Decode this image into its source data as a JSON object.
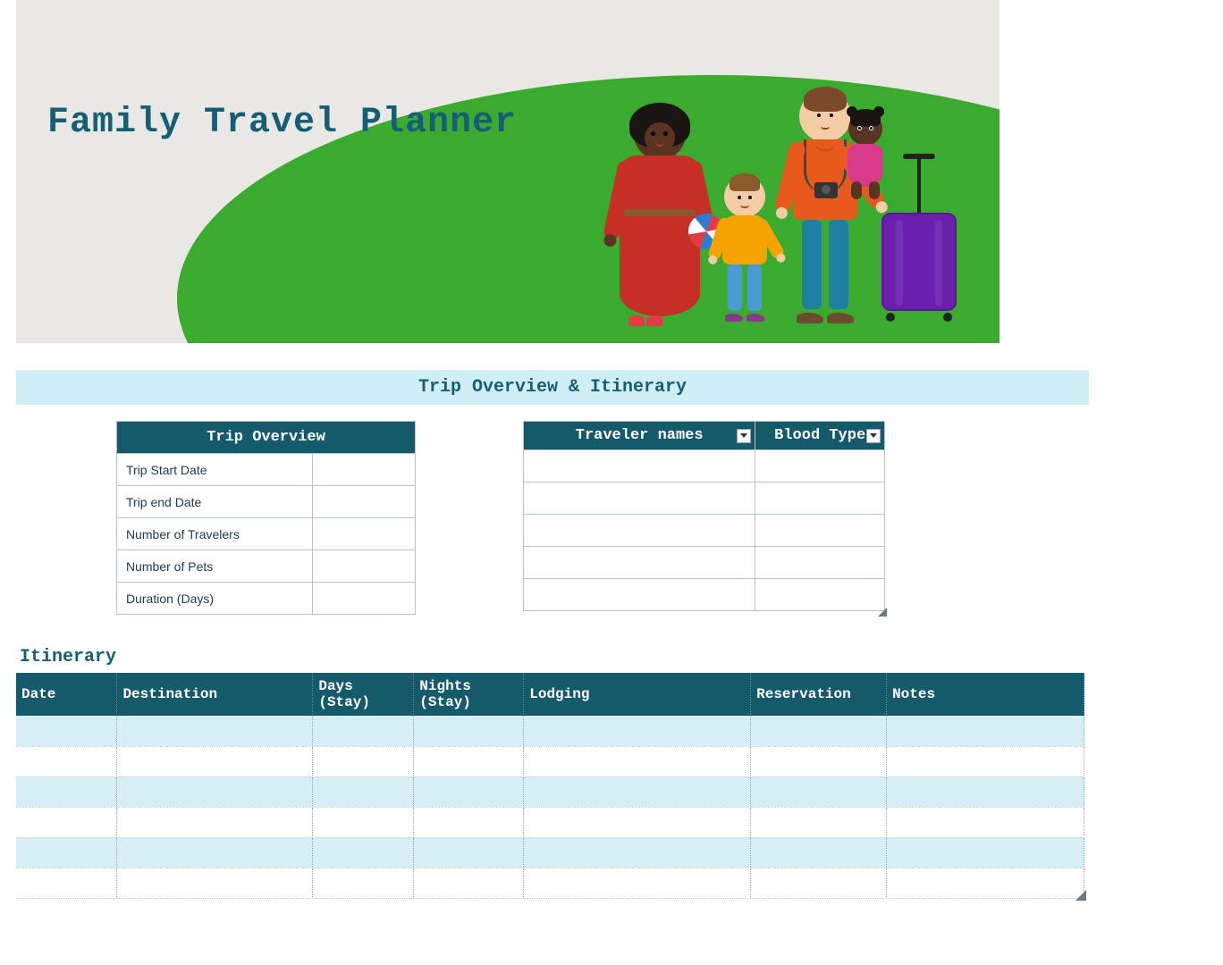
{
  "header": {
    "title": "Family Travel Planner"
  },
  "section": {
    "overview_title": "Trip Overview & Itinerary"
  },
  "trip_overview": {
    "header": "Trip Overview",
    "rows": [
      {
        "label": "Trip Start Date",
        "value": ""
      },
      {
        "label": "Trip end Date",
        "value": ""
      },
      {
        "label": "Number of Travelers",
        "value": ""
      },
      {
        "label": "Number of Pets",
        "value": ""
      },
      {
        "label": "Duration (Days)",
        "value": ""
      }
    ]
  },
  "travelers": {
    "col_names": "Traveler names",
    "col_blood": "Blood Type",
    "rows": [
      {
        "name": "",
        "blood": ""
      },
      {
        "name": "",
        "blood": ""
      },
      {
        "name": "",
        "blood": ""
      },
      {
        "name": "",
        "blood": ""
      },
      {
        "name": "",
        "blood": ""
      }
    ]
  },
  "itinerary": {
    "heading": "Itinerary",
    "columns": {
      "date": "Date",
      "destination": "Destination",
      "days": "Days (Stay)",
      "nights": "Nights (Stay)",
      "lodging": "Lodging",
      "reservation": "Reservation",
      "notes": "Notes"
    },
    "rows": [
      {
        "date": "",
        "destination": "",
        "days": "",
        "nights": "",
        "lodging": "",
        "reservation": "",
        "notes": ""
      },
      {
        "date": "",
        "destination": "",
        "days": "",
        "nights": "",
        "lodging": "",
        "reservation": "",
        "notes": ""
      },
      {
        "date": "",
        "destination": "",
        "days": "",
        "nights": "",
        "lodging": "",
        "reservation": "",
        "notes": ""
      },
      {
        "date": "",
        "destination": "",
        "days": "",
        "nights": "",
        "lodging": "",
        "reservation": "",
        "notes": ""
      },
      {
        "date": "",
        "destination": "",
        "days": "",
        "nights": "",
        "lodging": "",
        "reservation": "",
        "notes": ""
      },
      {
        "date": "",
        "destination": "",
        "days": "",
        "nights": "",
        "lodging": "",
        "reservation": "",
        "notes": ""
      }
    ]
  },
  "colors": {
    "teal_dark": "#145a6b",
    "teal_text": "#155e75",
    "section_bg": "#cfeef6",
    "row_alt": "#d6eef6"
  }
}
